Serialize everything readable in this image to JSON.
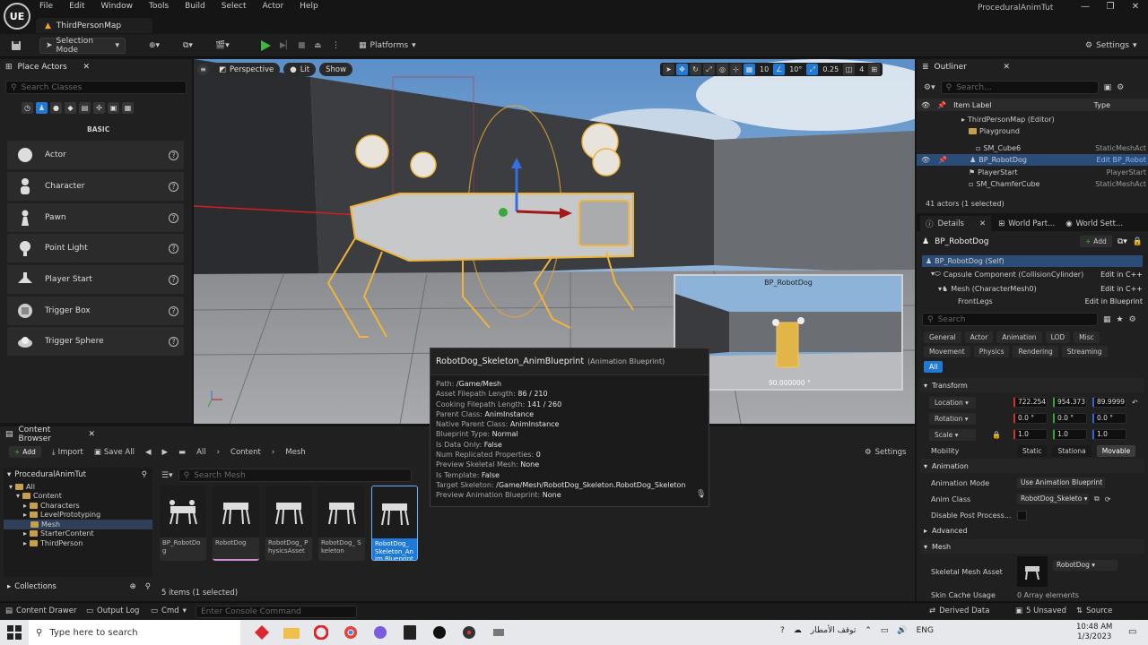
{
  "app": {
    "logo_text": "UE",
    "project_title": "ProceduralAnimTut",
    "map_tab": "ThirdPersonMap"
  },
  "menu": [
    "File",
    "Edit",
    "Window",
    "Tools",
    "Build",
    "Select",
    "Actor",
    "Help"
  ],
  "toolbar": {
    "selection_mode": "Selection Mode",
    "platforms": "Platforms",
    "settings": "Settings"
  },
  "place_actors": {
    "tab": "Place Actors",
    "search_placeholder": "Search Classes",
    "category": "BASIC",
    "items": [
      "Actor",
      "Character",
      "Pawn",
      "Point Light",
      "Player Start",
      "Trigger Box",
      "Trigger Sphere"
    ]
  },
  "viewport": {
    "perspective": "Perspective",
    "lit": "Lit",
    "show": "Show",
    "grid_snap": "10",
    "rot_snap": "10°",
    "scale_snap": "0.25",
    "cam_speed": "4",
    "preview_title": "BP_RobotDog",
    "preview_value": "90.000000 °"
  },
  "tooltip": {
    "title": "RobotDog_Skeleton_AnimBlueprint",
    "type": "(Animation Blueprint)",
    "rows": [
      {
        "k": "Path:",
        "v": "/Game/Mesh"
      },
      {
        "k": "Asset Filepath Length:",
        "v": "86 / 210"
      },
      {
        "k": "Cooking Filepath Length:",
        "v": "141 / 260"
      },
      {
        "k": "Parent Class:",
        "v": "AnimInstance"
      },
      {
        "k": "Native Parent Class:",
        "v": "AnimInstance"
      },
      {
        "k": "Blueprint Type:",
        "v": "Normal"
      },
      {
        "k": "Is Data Only:",
        "v": "False"
      },
      {
        "k": "Num Replicated Properties:",
        "v": "0"
      },
      {
        "k": "Preview Skeletal Mesh:",
        "v": "None"
      },
      {
        "k": "Is Template:",
        "v": "False"
      },
      {
        "k": "Target Skeleton:",
        "v": "/Game/Mesh/RobotDog_Skeleton.RobotDog_Skeleton"
      },
      {
        "k": "Preview Animation Blueprint:",
        "v": "None"
      }
    ]
  },
  "content_browser": {
    "tab": "Content Browser",
    "add": "Add",
    "import": "Import",
    "save_all": "Save All",
    "breadcrumb": [
      "All",
      "Content",
      "Mesh"
    ],
    "settings": "Settings",
    "root": "ProceduralAnimTut",
    "tree": [
      "All",
      "Content",
      "Characters",
      "LevelPrototyping",
      "Mesh",
      "StarterContent",
      "ThirdPerson"
    ],
    "search_placeholder": "Search Mesh",
    "assets": [
      "BP_RobotDog",
      "RobotDog",
      "RobotDog_ PhysicsAsset",
      "RobotDog_ Skeleton",
      "RobotDog_ Skeleton_Anim Blueprint"
    ],
    "collections": "Collections",
    "count": "5 items (1 selected)"
  },
  "outliner": {
    "tab": "Outliner",
    "search_placeholder": "Search...",
    "col_label": "Item Label",
    "col_type": "Type",
    "rows": [
      {
        "label": "ThirdPersonMap (Editor)",
        "type": ""
      },
      {
        "label": "Playground",
        "type": ""
      },
      {
        "label": "SM_Cube6",
        "type": "StaticMeshAct"
      },
      {
        "label": "BP_RobotDog",
        "type": "Edit BP_Robot"
      },
      {
        "label": "PlayerStart",
        "type": "PlayerStart"
      },
      {
        "label": "SM_ChamferCube",
        "type": "StaticMeshAct"
      }
    ],
    "count": "41 actors (1 selected)"
  },
  "details": {
    "tabs": [
      "Details",
      "World Part...",
      "World Sett..."
    ],
    "actor": "BP_RobotDog",
    "add": "Add",
    "components": [
      {
        "label": "BP_RobotDog (Self)",
        "link": ""
      },
      {
        "label": "Capsule Component (CollisionCylinder)",
        "link": "Edit in C++"
      },
      {
        "label": "Mesh (CharacterMesh0)",
        "link": "Edit in C++"
      },
      {
        "label": "FrontLegs",
        "link": "Edit in Blueprint"
      }
    ],
    "search_placeholder": "Search",
    "filters_row1": [
      "General",
      "Actor",
      "Animation",
      "LOD",
      "Misc"
    ],
    "filters_row2": [
      "Movement",
      "Physics",
      "Rendering",
      "Streaming"
    ],
    "filter_all": "All",
    "transform": "Transform",
    "location": "Location",
    "location_vals": [
      "722.254",
      "954.373",
      "89.9999"
    ],
    "rotation": "Rotation",
    "rotation_vals": [
      "0.0 °",
      "0.0 °",
      "0.0 °"
    ],
    "scale": "Scale",
    "scale_vals": [
      "1.0",
      "1.0",
      "1.0"
    ],
    "mobility": "Mobility",
    "mobility_opts": [
      "Static",
      "Stationa",
      "Movable"
    ],
    "animation": "Animation",
    "anim_mode": "Animation Mode",
    "anim_mode_val": "Use Animation Blueprint",
    "anim_class": "Anim Class",
    "anim_class_val": "RobotDog_Skeleto",
    "disable_post": "Disable Post Process...",
    "advanced": "Advanced",
    "mesh": "Mesh",
    "skeletal_mesh": "Skeletal Mesh Asset",
    "skeletal_mesh_val": "RobotDog",
    "skin_cache": "Skin Cache Usage",
    "skin_cache_val": "0 Array elements"
  },
  "status": {
    "content_drawer": "Content Drawer",
    "output_log": "Output Log",
    "cmd": "Cmd",
    "console_placeholder": "Enter Console Command",
    "derived": "Derived Data",
    "unsaved": "5 Unsaved",
    "source": "Source"
  },
  "taskbar": {
    "search_placeholder": "Type here to search",
    "weather": "توقف الأمطار",
    "lang": "ENG",
    "time": "10:48 AM",
    "date": "1/3/2023"
  },
  "colors": {
    "accent": "#1f7ad6",
    "play": "#3dba3d",
    "selection": "#f0b43a"
  }
}
